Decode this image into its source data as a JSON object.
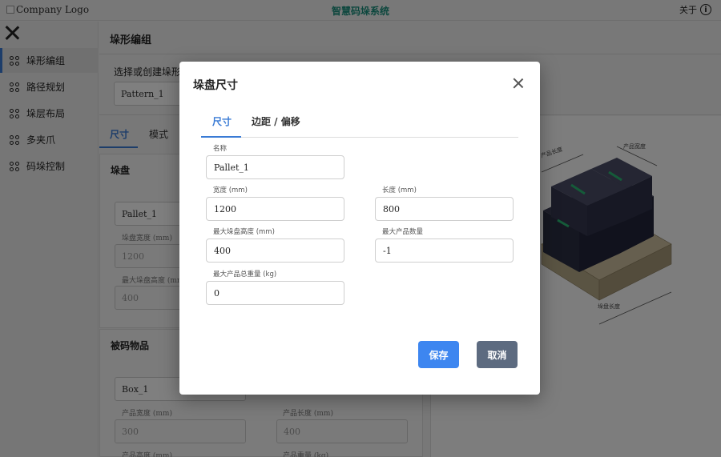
{
  "header": {
    "logo_alt": "Company Logo",
    "app_title": "智慧码垛系统",
    "about_label": "关于"
  },
  "sidebar": {
    "items": [
      {
        "label": "垛形编组",
        "active": true
      },
      {
        "label": "路径规划"
      },
      {
        "label": "垛层布局"
      },
      {
        "label": "多夹爪"
      },
      {
        "label": "码垛控制"
      }
    ]
  },
  "main": {
    "page_title": "垛形编组",
    "pattern_select_label": "选择或创建垛形编组",
    "pattern_value": "Pattern_1",
    "tabs": [
      "尺寸",
      "模式"
    ],
    "pallet_section": {
      "title": "垛盘",
      "name_value": "Pallet_1",
      "width_label": "垛盘宽度 (mm)",
      "width_value": "1200",
      "max_height_label": "最大垛盘高度 (mm)",
      "max_height_value": "400"
    },
    "item_section": {
      "title": "被码物品",
      "name_value": "Box_1",
      "width_label": "产品宽度 (mm)",
      "width_value": "300",
      "length_label": "产品长度 (mm)",
      "length_value": "400",
      "height_label": "产品高度 (mm)",
      "weight_label": "产品重量 (kg)"
    },
    "diagram_labels": {
      "product_length": "产品长度",
      "product_width": "产品宽度",
      "pallet_length": "垛盘长度"
    }
  },
  "modal": {
    "title": "垛盘尺寸",
    "tabs": [
      "尺寸",
      "边距 / 偏移"
    ],
    "active_tab": "尺寸",
    "fields": {
      "name": {
        "label": "名称",
        "value": "Pallet_1"
      },
      "width": {
        "label": "宽度 (mm)",
        "value": "1200"
      },
      "length": {
        "label": "长度 (mm)",
        "value": "800"
      },
      "max_height": {
        "label": "最大垛盘高度 (mm)",
        "value": "400"
      },
      "max_count": {
        "label": "最大产品数量",
        "value": "-1"
      },
      "max_weight": {
        "label": "最大产品总重量 (kg)",
        "value": "0"
      }
    },
    "save_label": "保存",
    "cancel_label": "取消"
  },
  "colors": {
    "accent": "#3a7bd5",
    "brand_title": "#1a8f7c",
    "save_button": "#3d86f0",
    "cancel_button": "#5d6b80"
  }
}
